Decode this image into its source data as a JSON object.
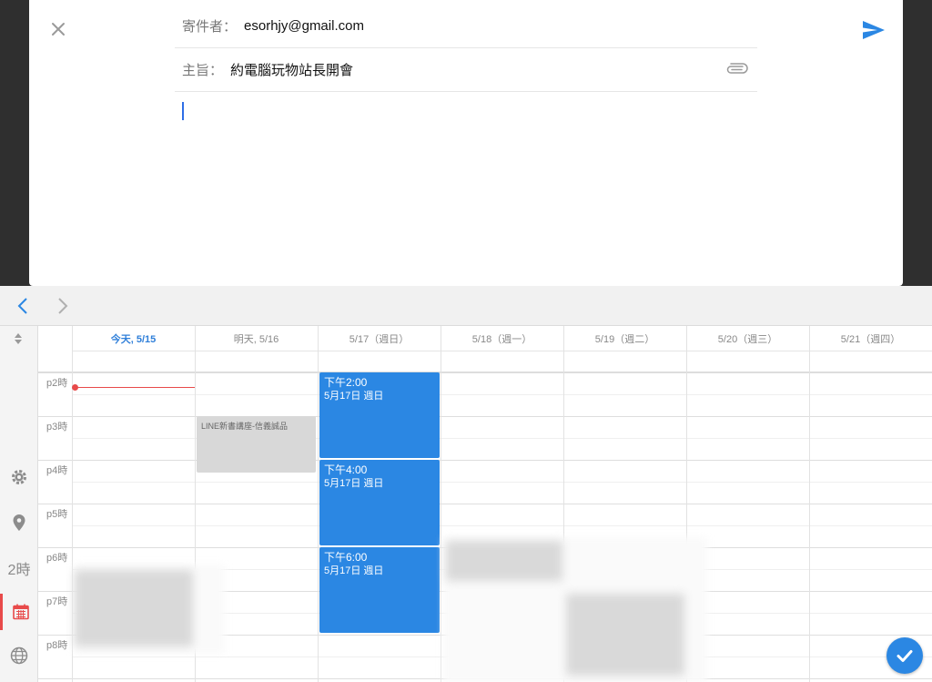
{
  "compose": {
    "from_label": "寄件者：",
    "from_value": "esorhjy@gmail.com",
    "subject_label": "主旨：",
    "subject_value": "約電腦玩物站長開會",
    "body": ""
  },
  "calendar": {
    "days": [
      {
        "label": "今天, 5/15",
        "today": true
      },
      {
        "label": "明天, 5/16",
        "today": false
      },
      {
        "label": "5/17（週日）",
        "today": false
      },
      {
        "label": "5/18（週一）",
        "today": false
      },
      {
        "label": "5/19（週二）",
        "today": false
      },
      {
        "label": "5/20（週三）",
        "today": false
      },
      {
        "label": "5/21（週四）",
        "today": false
      }
    ],
    "hours": [
      "p2時",
      "p3時",
      "p4時",
      "p5時",
      "p6時",
      "p7時",
      "p8時"
    ],
    "rail": {
      "duration_label": "2時"
    },
    "events": [
      {
        "time": "下午2:00",
        "date": "5月17日 週日"
      },
      {
        "time": "下午4:00",
        "date": "5月17日 週日"
      },
      {
        "time": "下午6:00",
        "date": "5月17日 週日"
      }
    ],
    "gray_event": {
      "title": "LINE新書講座-信義誠品"
    }
  },
  "colors": {
    "accent": "#2b87e3",
    "now_line": "#e84a4a",
    "active_rail": "#e84a4a"
  },
  "icons": [
    "close-icon",
    "send-icon",
    "paperclip-icon",
    "chevron-left-icon",
    "chevron-right-icon",
    "sort-arrows-icon",
    "gear-icon",
    "map-pin-icon",
    "calendar-icon",
    "globe-icon",
    "checkmark-icon"
  ]
}
